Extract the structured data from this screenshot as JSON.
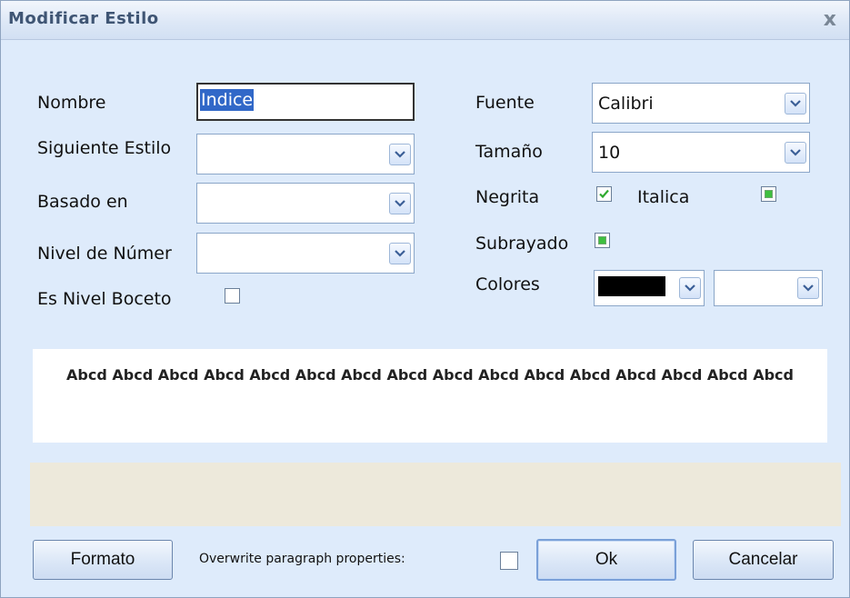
{
  "window": {
    "title": "Modificar Estilo",
    "close_glyph": "x"
  },
  "left": {
    "nombre_label": "Nombre",
    "nombre_value": "Indice",
    "siguiente_label": "Siguiente Estilo",
    "siguiente_value": "",
    "basado_label": "Basado en",
    "basado_value": "",
    "nivel_label": "Nivel de Númer",
    "nivel_value": "",
    "boceto_label": "Es Nivel Boceto",
    "boceto_checked": false
  },
  "right": {
    "fuente_label": "Fuente",
    "fuente_value": "Calibri",
    "tamano_label": "Tamaño",
    "tamano_value": "10",
    "negrita_label": "Negrita",
    "negrita_state": "checked",
    "italica_label": "Italica",
    "italica_state": "indeterminate",
    "subrayado_label": "Subrayado",
    "subrayado_state": "indeterminate",
    "colores_label": "Colores",
    "fore_color": "#000000",
    "back_color": "#ffffff"
  },
  "preview": {
    "text": "Abcd Abcd Abcd Abcd Abcd Abcd Abcd Abcd Abcd Abcd Abcd Abcd Abcd Abcd Abcd Abcd"
  },
  "footer": {
    "formato_label": "Formato",
    "overwrite_label": "Overwrite paragraph properties:",
    "overwrite_checked": false,
    "ok_label": "Ok",
    "cancel_label": "Cancelar"
  },
  "icons": {
    "dropdown": "chevron-down-icon",
    "check": "checkmark-icon",
    "indeterminate": "square-fill-icon"
  }
}
